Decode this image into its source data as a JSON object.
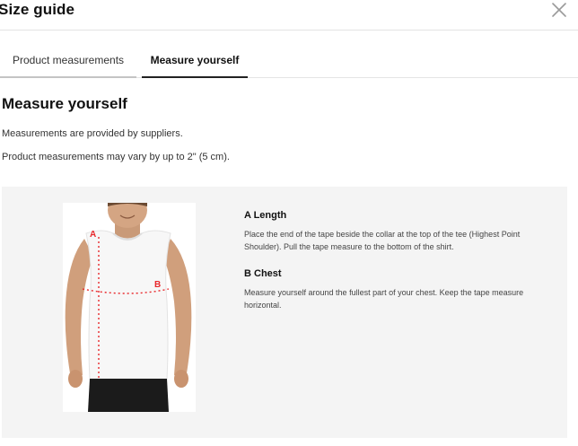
{
  "modal": {
    "title": "Size guide",
    "close_icon": "close-icon"
  },
  "tabs": [
    {
      "label": "Product measurements",
      "active": false
    },
    {
      "label": "Measure yourself",
      "active": true
    }
  ],
  "content": {
    "heading": "Measure yourself",
    "note_1": "Measurements are provided by suppliers.",
    "note_2": "Product measurements may vary by up to 2\" (5 cm)."
  },
  "figure": {
    "marker_a": "A",
    "marker_b": "B",
    "marker_color": "#e8282b"
  },
  "measurements": [
    {
      "title": "A Length",
      "text": "Place the end of the tape beside the collar at the top of the tee (Highest Point Shoulder). Pull the tape measure to the bottom of the shirt."
    },
    {
      "title": "B Chest",
      "text": "Measure yourself around the fullest part of your chest. Keep the tape measure horizontal."
    }
  ]
}
